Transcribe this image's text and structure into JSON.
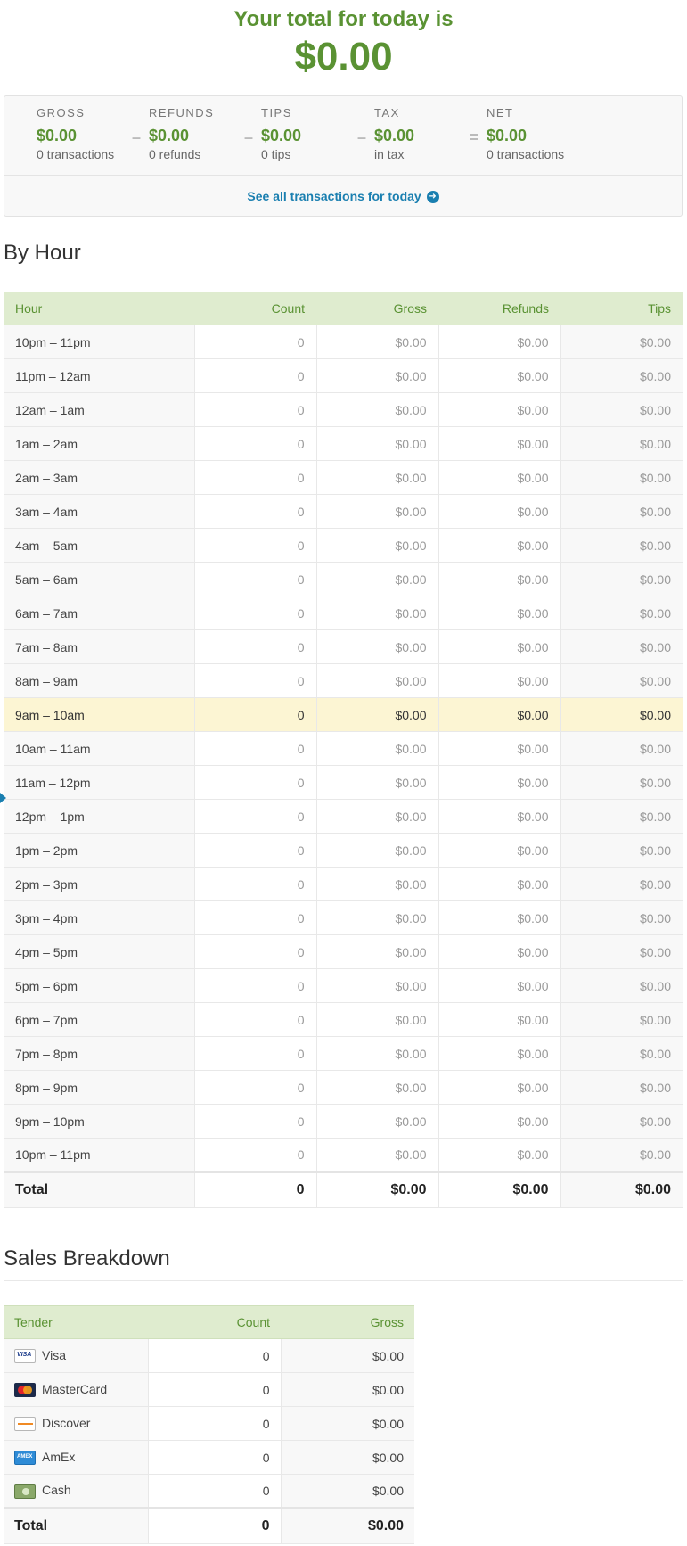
{
  "hero": {
    "title": "Your total for today is",
    "total": "$0.00"
  },
  "summary": {
    "columns": [
      {
        "label": "GROSS",
        "amount": "$0.00",
        "sub": "0 transactions"
      },
      {
        "label": "REFUNDS",
        "amount": "$0.00",
        "sub": "0 refunds"
      },
      {
        "label": "TIPS",
        "amount": "$0.00",
        "sub": "0 tips"
      },
      {
        "label": "TAX",
        "amount": "$0.00",
        "sub": "in tax"
      },
      {
        "label": "NET",
        "amount": "$0.00",
        "sub": "0 transactions"
      }
    ],
    "operators": [
      "–",
      "–",
      "–",
      "="
    ],
    "see_all": "See all transactions for today"
  },
  "by_hour": {
    "title": "By Hour",
    "headers": [
      "Hour",
      "Count",
      "Gross",
      "Refunds",
      "Tips"
    ],
    "rows": [
      [
        "10pm – 11pm",
        "0",
        "$0.00",
        "$0.00",
        "$0.00"
      ],
      [
        "11pm – 12am",
        "0",
        "$0.00",
        "$0.00",
        "$0.00"
      ],
      [
        "12am – 1am",
        "0",
        "$0.00",
        "$0.00",
        "$0.00"
      ],
      [
        "1am – 2am",
        "0",
        "$0.00",
        "$0.00",
        "$0.00"
      ],
      [
        "2am – 3am",
        "0",
        "$0.00",
        "$0.00",
        "$0.00"
      ],
      [
        "3am – 4am",
        "0",
        "$0.00",
        "$0.00",
        "$0.00"
      ],
      [
        "4am – 5am",
        "0",
        "$0.00",
        "$0.00",
        "$0.00"
      ],
      [
        "5am – 6am",
        "0",
        "$0.00",
        "$0.00",
        "$0.00"
      ],
      [
        "6am – 7am",
        "0",
        "$0.00",
        "$0.00",
        "$0.00"
      ],
      [
        "7am – 8am",
        "0",
        "$0.00",
        "$0.00",
        "$0.00"
      ],
      [
        "8am – 9am",
        "0",
        "$0.00",
        "$0.00",
        "$0.00"
      ],
      [
        "9am – 10am",
        "0",
        "$0.00",
        "$0.00",
        "$0.00"
      ],
      [
        "10am – 11am",
        "0",
        "$0.00",
        "$0.00",
        "$0.00"
      ],
      [
        "11am – 12pm",
        "0",
        "$0.00",
        "$0.00",
        "$0.00"
      ],
      [
        "12pm – 1pm",
        "0",
        "$0.00",
        "$0.00",
        "$0.00"
      ],
      [
        "1pm – 2pm",
        "0",
        "$0.00",
        "$0.00",
        "$0.00"
      ],
      [
        "2pm – 3pm",
        "0",
        "$0.00",
        "$0.00",
        "$0.00"
      ],
      [
        "3pm – 4pm",
        "0",
        "$0.00",
        "$0.00",
        "$0.00"
      ],
      [
        "4pm – 5pm",
        "0",
        "$0.00",
        "$0.00",
        "$0.00"
      ],
      [
        "5pm – 6pm",
        "0",
        "$0.00",
        "$0.00",
        "$0.00"
      ],
      [
        "6pm – 7pm",
        "0",
        "$0.00",
        "$0.00",
        "$0.00"
      ],
      [
        "7pm – 8pm",
        "0",
        "$0.00",
        "$0.00",
        "$0.00"
      ],
      [
        "8pm – 9pm",
        "0",
        "$0.00",
        "$0.00",
        "$0.00"
      ],
      [
        "9pm – 10pm",
        "0",
        "$0.00",
        "$0.00",
        "$0.00"
      ],
      [
        "10pm – 11pm",
        "0",
        "$0.00",
        "$0.00",
        "$0.00"
      ]
    ],
    "current_row_index": 11,
    "total": [
      "Total",
      "0",
      "$0.00",
      "$0.00",
      "$0.00"
    ]
  },
  "sales_breakdown": {
    "title": "Sales Breakdown",
    "headers": [
      "Tender",
      "Count",
      "Gross"
    ],
    "rows": [
      {
        "icon": "visa-card-icon",
        "name": "Visa",
        "count": "0",
        "gross": "$0.00"
      },
      {
        "icon": "mastercard-icon",
        "name": "MasterCard",
        "count": "0",
        "gross": "$0.00"
      },
      {
        "icon": "discover-card-icon",
        "name": "Discover",
        "count": "0",
        "gross": "$0.00"
      },
      {
        "icon": "amex-card-icon",
        "name": "AmEx",
        "count": "0",
        "gross": "$0.00"
      },
      {
        "icon": "cash-icon",
        "name": "Cash",
        "count": "0",
        "gross": "$0.00"
      }
    ],
    "total": [
      "Total",
      "0",
      "$0.00"
    ]
  },
  "colors": {
    "accent_green": "#5a9233",
    "header_green_bg": "#dfeccf",
    "link_blue": "#1a7fb0",
    "current_row_bg": "#fcf5d3"
  }
}
